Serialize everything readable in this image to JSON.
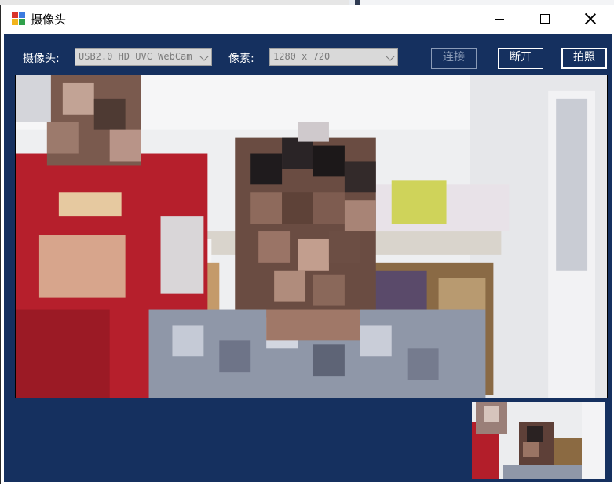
{
  "window": {
    "title": "摄像头"
  },
  "toolbar": {
    "camera_label": "摄像头:",
    "camera_value": "USB2.0 HD UVC WebCam",
    "resolution_label": "像素:",
    "resolution_value": "1280 x 720",
    "connect_label": "连接",
    "disconnect_label": "断开",
    "capture_label": "拍照"
  },
  "icons": {
    "app": "camera-app-icon",
    "minimize": "minimize-icon",
    "maximize": "maximize-icon",
    "close": "close-icon",
    "dropdown": "chevron-down-icon"
  },
  "colors": {
    "client_background": "#15305f",
    "disabled_button": "#8a9bb7",
    "button_text": "#ffffff"
  }
}
